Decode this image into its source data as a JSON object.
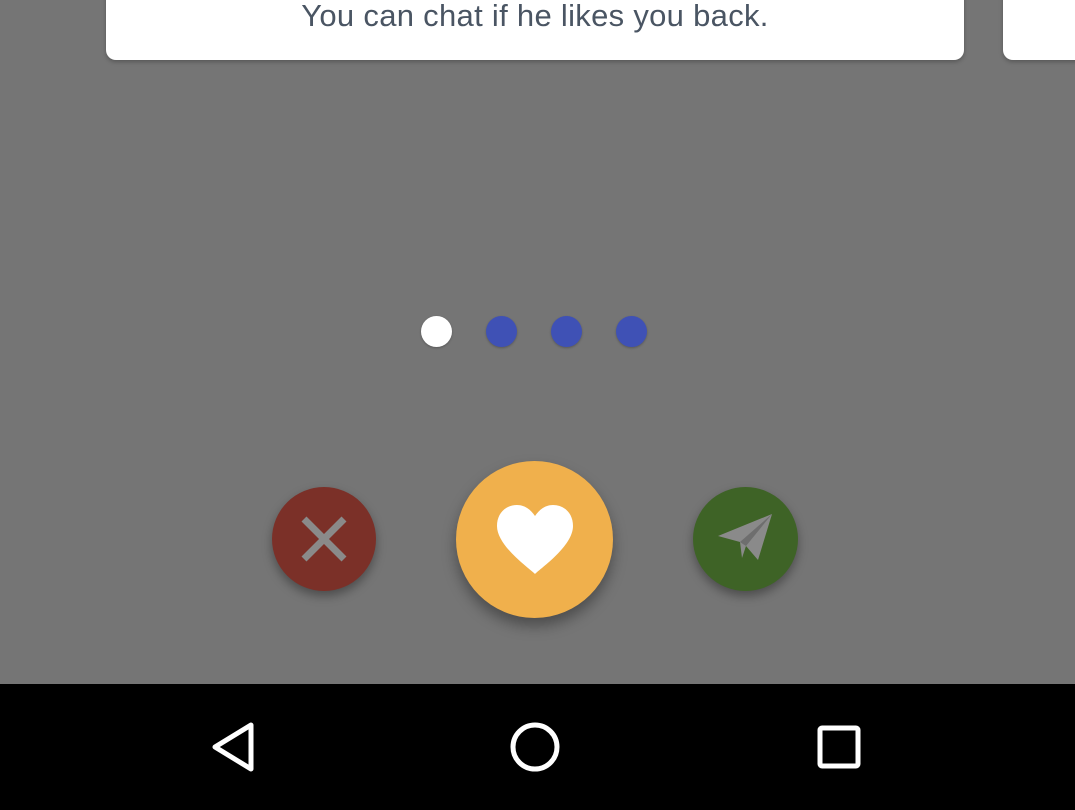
{
  "card": {
    "text": "You can chat if he likes you back."
  },
  "pager": {
    "count": 4,
    "active_index": 0,
    "active_color": "#ffffff",
    "inactive_color": "#3f51b5"
  },
  "actions": {
    "dislike": {
      "icon": "close-icon",
      "color": "#7b3028",
      "icon_color": "#8a8a8a"
    },
    "like": {
      "icon": "heart-icon",
      "color": "#f0b04c",
      "icon_color": "#ffffff"
    },
    "message": {
      "icon": "paper-plane-icon",
      "color": "#3e6326",
      "icon_color": "#8a8a8a"
    }
  },
  "navbar": {
    "items": [
      {
        "icon": "back-triangle-icon"
      },
      {
        "icon": "home-circle-icon"
      },
      {
        "icon": "recents-square-icon"
      }
    ]
  }
}
